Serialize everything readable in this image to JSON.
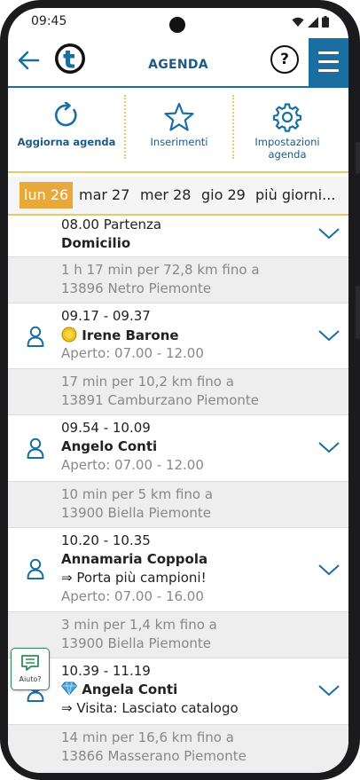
{
  "status": {
    "time": "09:45"
  },
  "header": {
    "title": "AGENDA",
    "help_label": "?"
  },
  "toolbar": {
    "refresh_label": "Aggiorna agenda",
    "entries_label": "Inserimenti",
    "settings_label_1": "Impostazioni",
    "settings_label_2": "agenda"
  },
  "days": [
    "lun 26",
    "mar 27",
    "mer 28",
    "gio 29",
    "più giorni..."
  ],
  "start": {
    "time": "08.00 Partenza",
    "place": "Domicilio"
  },
  "travels": [
    {
      "line1": "1 h 17 min per 72,8 km fino a",
      "line2": "13896 Netro Piemonte"
    },
    {
      "line1": "17 min per 10,2 km fino a",
      "line2": "13891 Camburzano Piemonte"
    },
    {
      "line1": "10 min per 5 km fino a",
      "line2": "13900 Biella Piemonte"
    },
    {
      "line1": "3 min per 1,4 km fino a",
      "line2": "13900 Biella Piemonte"
    },
    {
      "line1": "14 min per 16,6 km fino a",
      "line2": "13866 Masserano Piemonte"
    }
  ],
  "appointments": [
    {
      "time": "09.17 - 09.37",
      "name": "Irene Barone",
      "opening": "Aperto: 07.00 - 12.00"
    },
    {
      "time": "09.54 - 10.09",
      "name": "Angelo Conti",
      "opening": "Aperto: 07.00 - 12.00"
    },
    {
      "time": "10.20 - 10.35",
      "name": "Annamaria Coppola",
      "note": "⇒ Porta più campioni!",
      "opening": "Aperto: 07.00 - 16.00"
    },
    {
      "time": "10.39 - 11.19",
      "name": "Angela Conti",
      "note": "⇒ Visita: Lasciato catalogo"
    }
  ],
  "help_button": {
    "label": "Aiuto?"
  },
  "colors": {
    "primary": "#1a6ea0",
    "accent": "#e9a93a"
  }
}
